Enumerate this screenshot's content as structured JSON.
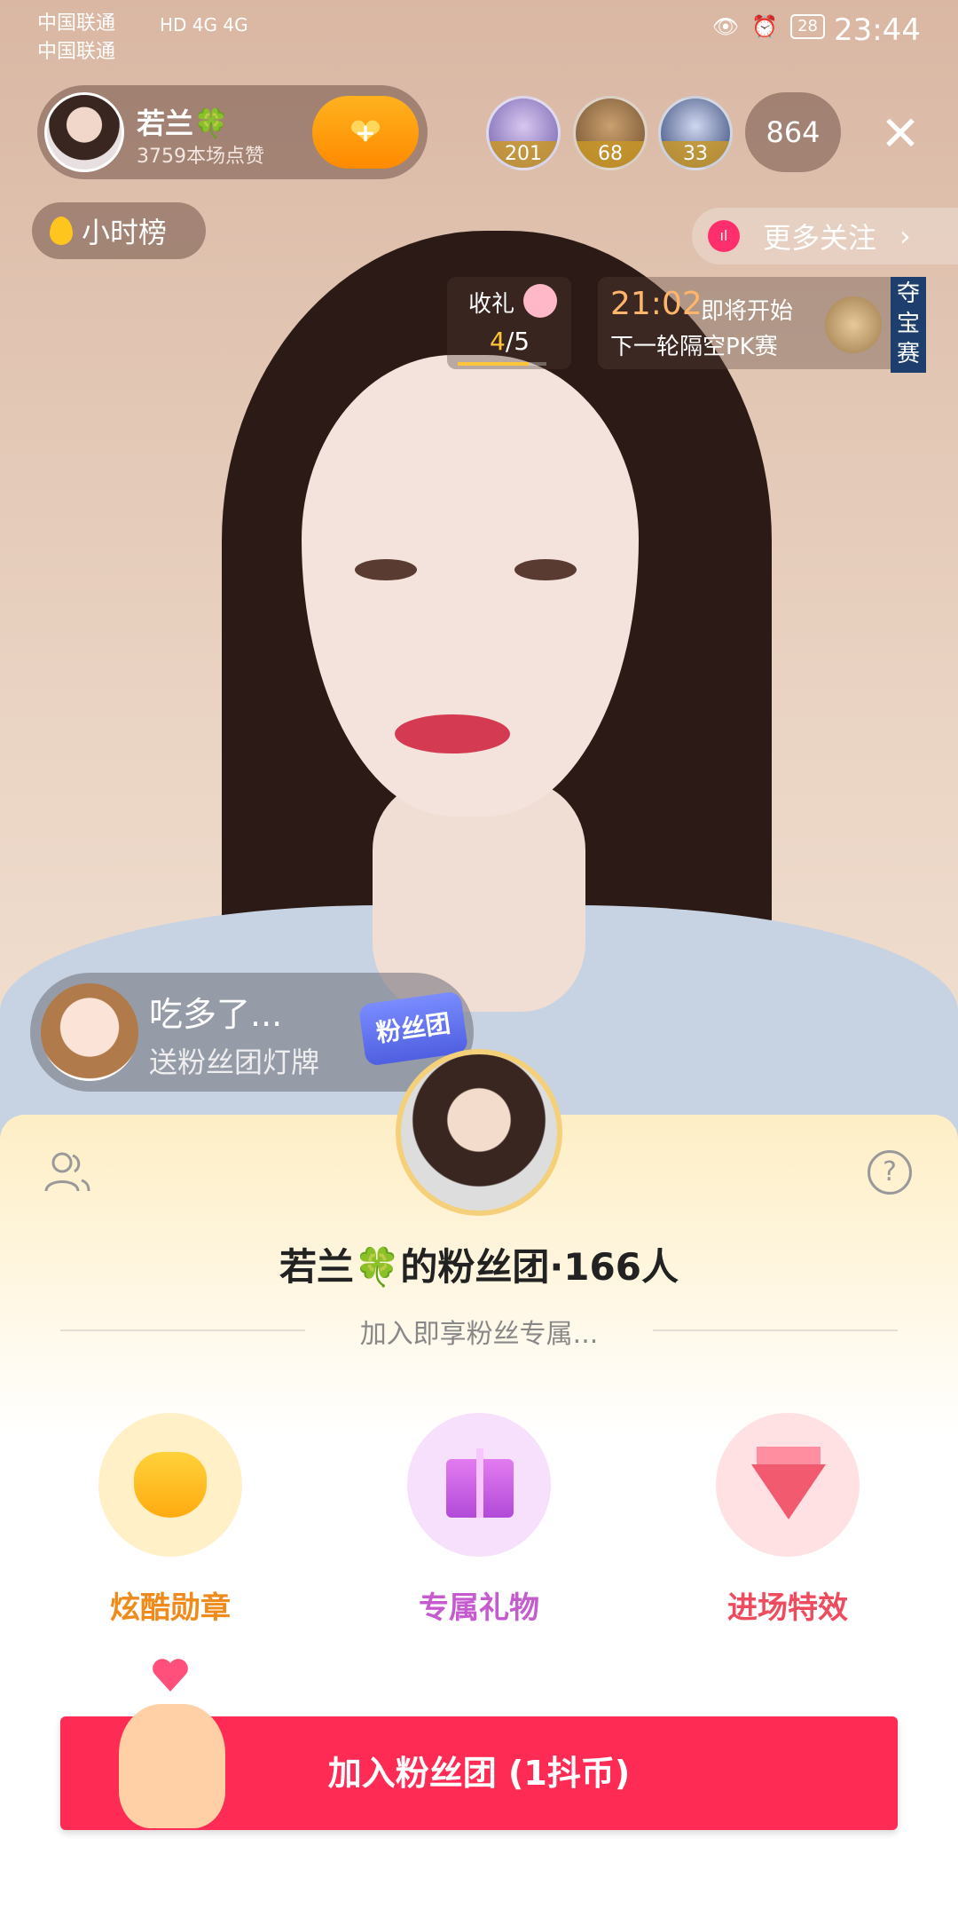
{
  "status_bar": {
    "carrier1": "中国联通",
    "carrier2": "中国联通",
    "network": "HD 4G 4G",
    "battery": "28",
    "time": "23:44"
  },
  "host": {
    "name": "若兰🍀",
    "likes": "3759本场点赞"
  },
  "viewers": [
    {
      "count": "201"
    },
    {
      "count": "68"
    },
    {
      "count": "33"
    }
  ],
  "viewer_total": "864",
  "close_glyph": "✕",
  "hourly_rank": "小时榜",
  "more_follow": "更多关注",
  "more_follow_arrow": "›",
  "gift_task": {
    "label": "收礼",
    "progress_done": "4",
    "progress_total": "/5",
    "progress": 0.8
  },
  "pk": {
    "time": "21:02",
    "soon": "即将开始",
    "next": "下一轮隔空PK赛"
  },
  "treasure_tag": "夺宝赛",
  "gift_message": {
    "user": "吃多了...",
    "desc": "送粉丝团灯牌"
  },
  "fan_badge": "粉丝团",
  "fan_club": {
    "title": "若兰🍀的粉丝团·166人",
    "subtitle": "加入即享粉丝专属..."
  },
  "perks": [
    {
      "label": "炫酷勋章",
      "icon": "heart-badge-icon"
    },
    {
      "label": "专属礼物",
      "icon": "gift-box-icon"
    },
    {
      "label": "进场特效",
      "icon": "diamond-icon"
    }
  ],
  "help_glyph": "?",
  "join_button": "加入粉丝团 (1抖币)",
  "colors": {
    "accent": "#fe2c55",
    "gold": "#f08a1a",
    "purple": "#c65bd0",
    "red": "#ef4b5e"
  }
}
